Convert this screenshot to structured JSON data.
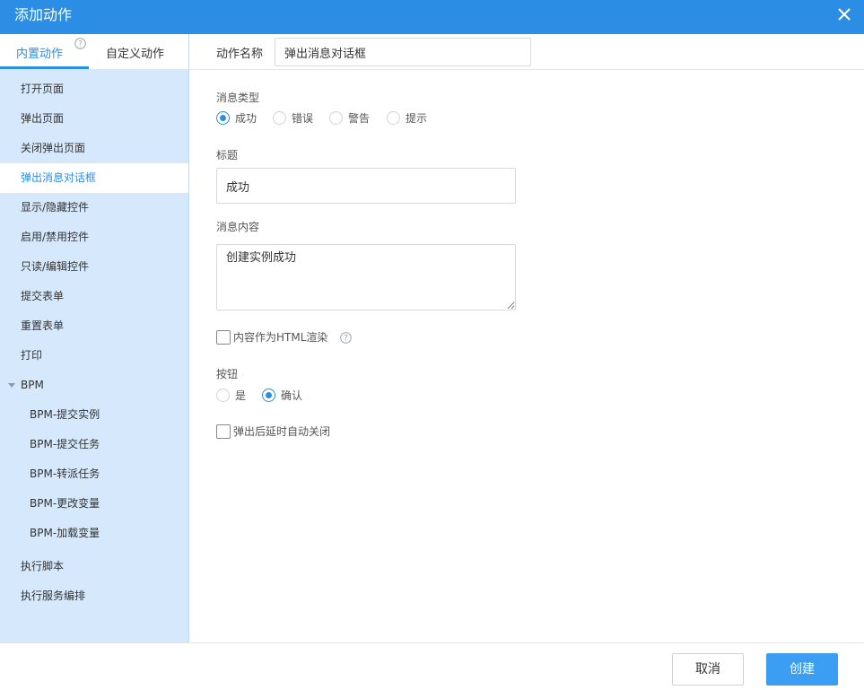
{
  "dialog": {
    "title": "添加动作",
    "close_icon": "close-icon"
  },
  "tabs": {
    "builtin": "内置动作",
    "custom": "自定义动作"
  },
  "sidebar": {
    "items": [
      {
        "label": "打开页面"
      },
      {
        "label": "弹出页面"
      },
      {
        "label": "关闭弹出页面"
      },
      {
        "label": "弹出消息对话框",
        "active": true
      },
      {
        "label": "显示/隐藏控件"
      },
      {
        "label": "启用/禁用控件"
      },
      {
        "label": "只读/编辑控件"
      },
      {
        "label": "提交表单"
      },
      {
        "label": "重置表单"
      },
      {
        "label": "打印"
      },
      {
        "label": "BPM",
        "group": true
      },
      {
        "label": "BPM-提交实例"
      },
      {
        "label": "BPM-提交任务"
      },
      {
        "label": "BPM-转派任务"
      },
      {
        "label": "BPM-更改变量"
      },
      {
        "label": "BPM-加载变量"
      },
      {
        "label": "执行脚本"
      },
      {
        "label": "执行服务编排"
      }
    ]
  },
  "form": {
    "action_name_label": "动作名称",
    "action_name_value": "弹出消息对话框",
    "message_type_label": "消息类型",
    "message_types": [
      "成功",
      "错误",
      "警告",
      "提示"
    ],
    "message_type_selected": "成功",
    "title_label": "标题",
    "title_value": "成功",
    "content_label": "消息内容",
    "content_value": "创建实例成功",
    "html_render_label": "内容作为HTML渲染",
    "html_render_checked": false,
    "button_label": "按钮",
    "button_options": [
      "是",
      "确认"
    ],
    "button_selected": "确认",
    "auto_close_label": "弹出后延时自动关闭",
    "auto_close_checked": false
  },
  "footer": {
    "cancel_label": "取消",
    "create_label": "创建"
  },
  "colors": {
    "accent": "#2b8de3",
    "sidebar_bg": "#d6e9fc",
    "create_button": "#3c9ef2"
  }
}
